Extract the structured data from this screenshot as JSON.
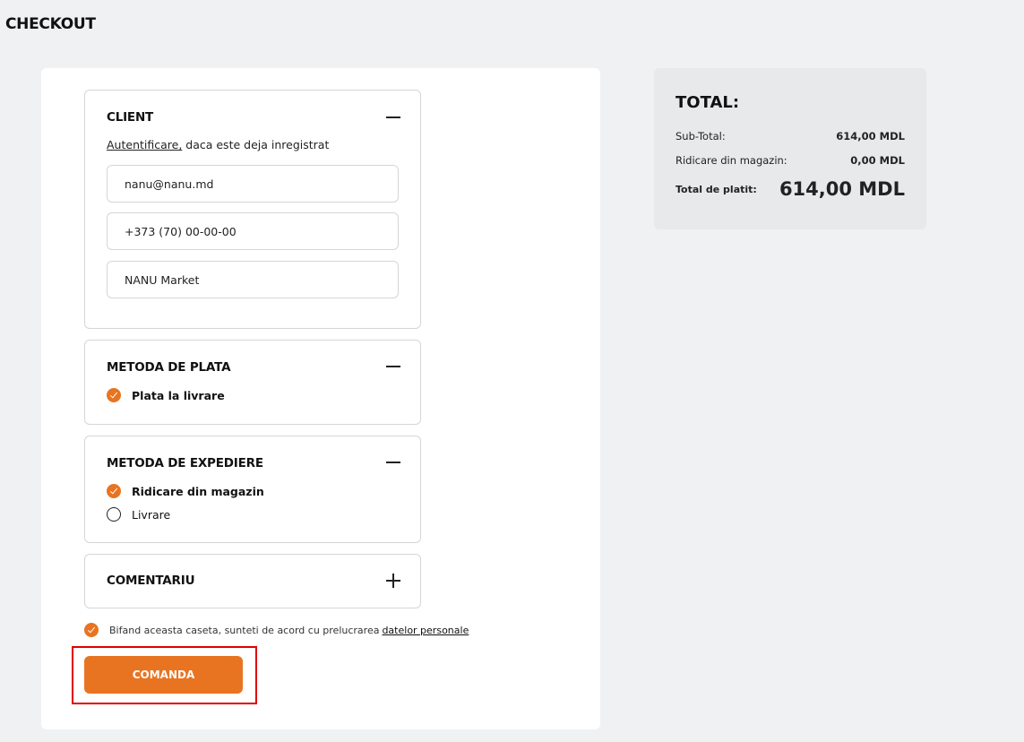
{
  "page": {
    "title": "CHECKOUT"
  },
  "client": {
    "title": "CLIENT",
    "auth_link": "Autentificare,",
    "auth_text": " daca este deja inregistrat",
    "email_value": "nanu@nanu.md",
    "phone_value": "+373 (70) 00-00-00",
    "name_value": "NANU Market"
  },
  "payment": {
    "title": "METODA DE PLATA",
    "options": [
      {
        "label": "Plata la livrare",
        "checked": true
      }
    ]
  },
  "shipping": {
    "title": "METODA DE EXPEDIERE",
    "options": [
      {
        "label": "Ridicare din magazin",
        "checked": true
      },
      {
        "label": "Livrare",
        "checked": false
      }
    ]
  },
  "comment": {
    "title": "COMENTARIU"
  },
  "consent": {
    "text": "Bifand aceasta caseta, sunteti de acord cu prelucrarea",
    "link": "datelor personale",
    "checked": true
  },
  "submit": {
    "label": "COMANDA"
  },
  "totals": {
    "title": "TOTAL:",
    "rows": [
      {
        "label": "Sub-Total:",
        "value": "614,00  MDL"
      },
      {
        "label": "Ridicare din magazin:",
        "value": "0,00  MDL"
      }
    ],
    "grand": {
      "label": "Total de platit:",
      "value": "614,00 MDL"
    }
  },
  "colors": {
    "accent": "#e87422",
    "highlight": "#e00000",
    "background": "#eff1f2"
  }
}
